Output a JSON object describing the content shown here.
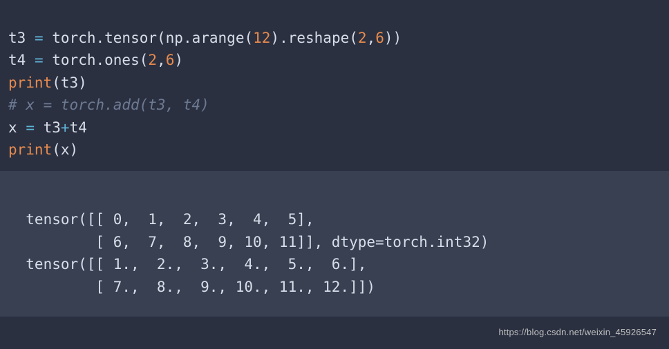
{
  "code": {
    "l1": {
      "var": "t3",
      "eq": "=",
      "obj1": "torch",
      "dot1": ".",
      "fn1": "tensor",
      "lp1": "(",
      "obj2": "np",
      "dot2": ".",
      "fn2": "arange",
      "lp2": "(",
      "arg1": "12",
      "rp1": ")",
      "dot3": ".",
      "fn3": "reshape",
      "lp3": "(",
      "arg2": "2",
      "comma": ",",
      "arg3": "6",
      "rp2": ")",
      "rp3": ")"
    },
    "l2": {
      "var": "t4",
      "eq": "=",
      "obj1": "torch",
      "dot1": ".",
      "fn1": "ones",
      "lp1": "(",
      "arg1": "2",
      "comma": ",",
      "arg2": "6",
      "rp1": ")"
    },
    "l3": {
      "fn": "print",
      "lp": "(",
      "arg": "t3",
      "rp": ")"
    },
    "l4": {
      "comment": "# x = torch.add(t3, t4)"
    },
    "l5": {
      "var": "x",
      "eq": "=",
      "a": "t3",
      "plus": "+",
      "b": "t4"
    },
    "l6": {
      "fn": "print",
      "lp": "(",
      "arg": "x",
      "rp": ")"
    }
  },
  "output": {
    "l1": "  tensor([[ 0,  1,  2,  3,  4,  5],",
    "l2": "          [ 6,  7,  8,  9, 10, 11]], dtype=torch.int32)",
    "l3": "  tensor([[ 1.,  2.,  3.,  4.,  5.,  6.],",
    "l4": "          [ 7.,  8.,  9., 10., 11., 12.]])"
  },
  "watermark": "https://blog.csdn.net/weixin_45926547",
  "chart_data": {
    "type": "table",
    "tensors": [
      {
        "name": "t3",
        "dtype": "torch.int32",
        "shape": [
          2,
          6
        ],
        "data": [
          [
            0,
            1,
            2,
            3,
            4,
            5
          ],
          [
            6,
            7,
            8,
            9,
            10,
            11
          ]
        ]
      },
      {
        "name": "x",
        "dtype": "float",
        "shape": [
          2,
          6
        ],
        "data": [
          [
            1.0,
            2.0,
            3.0,
            4.0,
            5.0,
            6.0
          ],
          [
            7.0,
            8.0,
            9.0,
            10.0,
            11.0,
            12.0
          ]
        ]
      }
    ]
  }
}
